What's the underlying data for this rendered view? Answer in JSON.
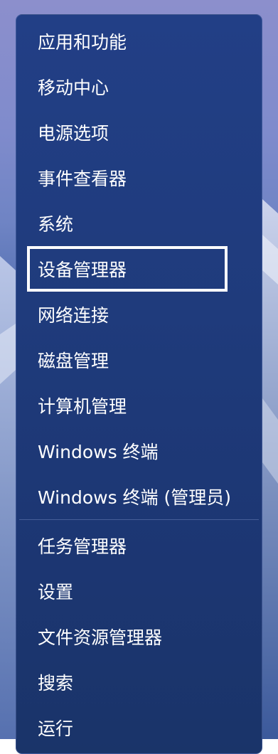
{
  "menu": {
    "items": [
      {
        "label": "应用和功能"
      },
      {
        "label": "移动中心"
      },
      {
        "label": "电源选项"
      },
      {
        "label": "事件查看器"
      },
      {
        "label": "系统"
      },
      {
        "label": "设备管理器",
        "focused": true
      },
      {
        "label": "网络连接"
      },
      {
        "label": "磁盘管理"
      },
      {
        "label": "计算机管理"
      },
      {
        "label": "Windows 终端"
      },
      {
        "label": "Windows 终端 (管理员)"
      },
      {
        "label": "任务管理器"
      },
      {
        "label": "设置"
      },
      {
        "label": "文件资源管理器"
      },
      {
        "label": "搜索"
      },
      {
        "label": "运行"
      }
    ]
  },
  "colors": {
    "menu_background": "#1f3b7c",
    "text": "#ffffff",
    "focus_outline": "#ffffff"
  }
}
